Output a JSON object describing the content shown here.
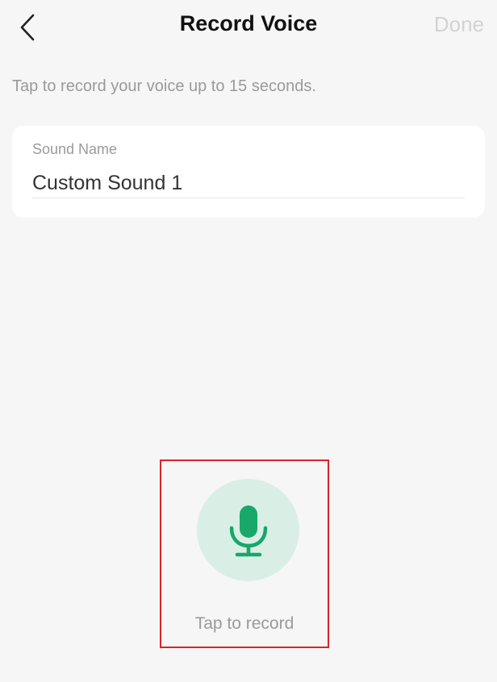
{
  "header": {
    "title": "Record Voice",
    "done_label": "Done",
    "back_icon": "chevron-left-icon"
  },
  "instruction": "Tap to record your voice up to 15 seconds.",
  "sound_name": {
    "label": "Sound Name",
    "value": "Custom Sound 1",
    "placeholder": ""
  },
  "record": {
    "label": "Tap to record",
    "icon": "microphone-icon"
  },
  "colors": {
    "background": "#f6f6f6",
    "accent_green": "#17a86a",
    "mic_circle": "#d9efe5",
    "done_disabled": "#d3d3d3",
    "highlight_border": "#d8232a"
  }
}
